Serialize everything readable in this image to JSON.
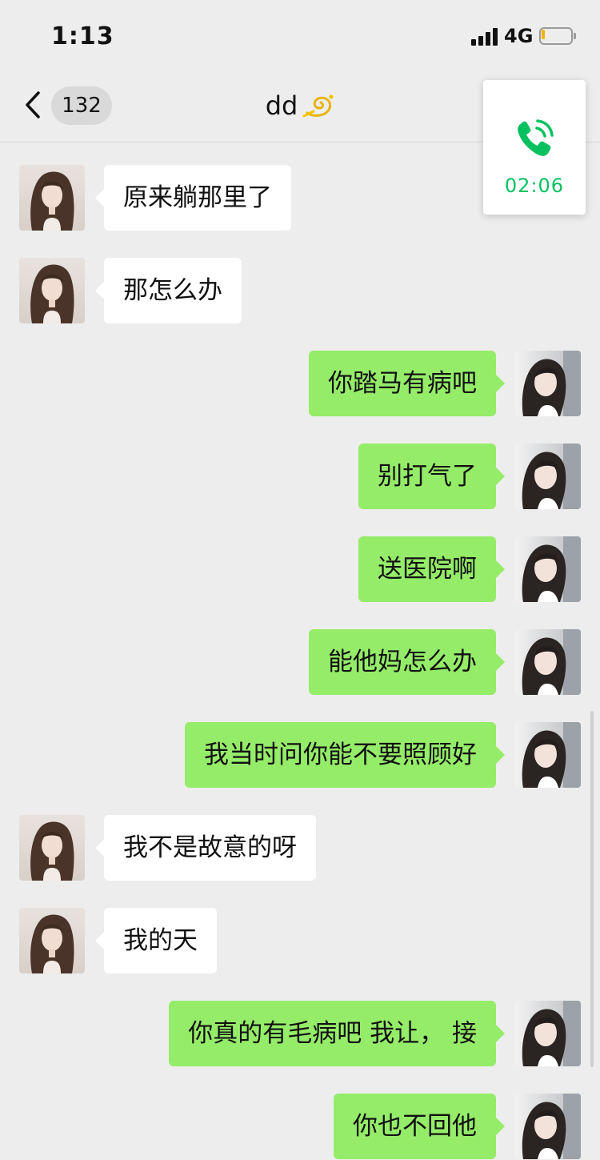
{
  "status_bar": {
    "time": "1:13",
    "network": "4G",
    "battery_level": 0.12,
    "battery_color": "#f2b301"
  },
  "nav": {
    "back_icon": "chevron-left-icon",
    "unread_count": "132",
    "title": "dd",
    "title_emoji": "dizzy-icon"
  },
  "call": {
    "icon": "phone-icon",
    "duration": "02:06",
    "color": "#07c160"
  },
  "colors": {
    "background": "#ededed",
    "incoming_bubble": "#ffffff",
    "outgoing_bubble": "#95ec69"
  },
  "messages": [
    {
      "side": "left",
      "text": "原来躺那里了"
    },
    {
      "side": "left",
      "text": "那怎么办"
    },
    {
      "side": "right",
      "text": "你踏马有病吧"
    },
    {
      "side": "right",
      "text": "别打气了"
    },
    {
      "side": "right",
      "text": "送医院啊"
    },
    {
      "side": "right",
      "text": "能他妈怎么办"
    },
    {
      "side": "right",
      "text": "我当时问你能不要照顾好"
    },
    {
      "side": "left",
      "text": "我不是故意的呀"
    },
    {
      "side": "left",
      "text": "我的天"
    },
    {
      "side": "right",
      "text": "你真的有毛病吧 我让，  接"
    },
    {
      "side": "right",
      "text": "你也不回他"
    }
  ]
}
